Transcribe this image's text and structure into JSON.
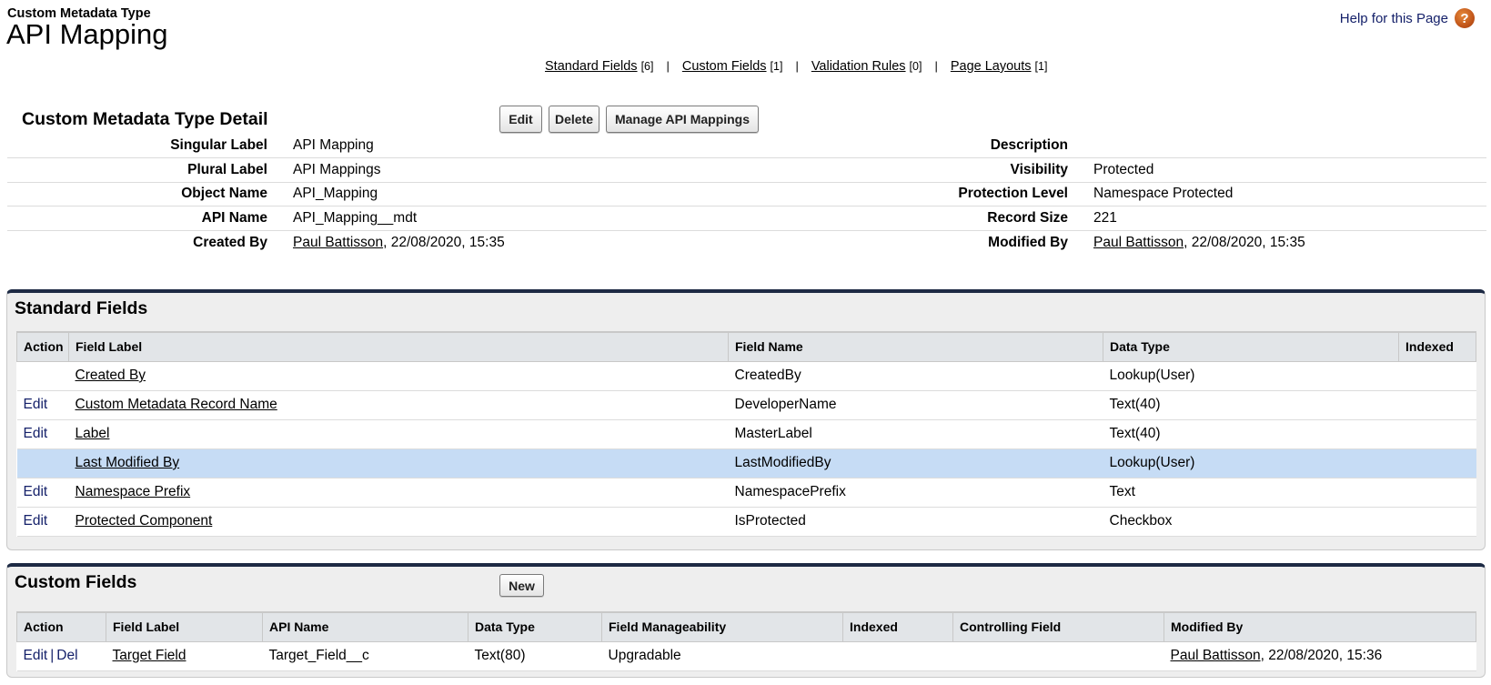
{
  "header": {
    "object_type": "Custom Metadata Type",
    "title": "API Mapping",
    "help_link": "Help for this Page",
    "help_icon": "question-mark-icon"
  },
  "related_links": [
    {
      "label": "Standard Fields",
      "count": "[6]"
    },
    {
      "label": "Custom Fields",
      "count": "[1]"
    },
    {
      "label": "Validation Rules",
      "count": "[0]"
    },
    {
      "label": "Page Layouts",
      "count": "[1]"
    }
  ],
  "related_separator": "|",
  "detail": {
    "title": "Custom Metadata Type Detail",
    "buttons": {
      "edit": "Edit",
      "delete": "Delete",
      "manage": "Manage API Mappings"
    },
    "rows": [
      {
        "left_label": "Singular Label",
        "left_value": "API Mapping",
        "right_label": "Description",
        "right_value": ""
      },
      {
        "left_label": "Plural Label",
        "left_value": "API Mappings",
        "right_label": "Visibility",
        "right_value": "Protected"
      },
      {
        "left_label": "Object Name",
        "left_value": "API_Mapping",
        "right_label": "Protection Level",
        "right_value": "Namespace Protected"
      },
      {
        "left_label": "API Name",
        "left_value": "API_Mapping__mdt",
        "right_label": "Record Size",
        "right_value": "221"
      }
    ],
    "created_by": {
      "label": "Created By",
      "user": "Paul Battisson",
      "date": ", 22/08/2020, 15:35"
    },
    "modified_by": {
      "label": "Modified By",
      "user": "Paul Battisson",
      "date": ", 22/08/2020, 15:35"
    }
  },
  "standard_fields": {
    "title": "Standard Fields",
    "columns": [
      "Action",
      "Field Label",
      "Field Name",
      "Data Type",
      "Indexed"
    ],
    "rows": [
      {
        "action": "",
        "label": "Created By",
        "name": "CreatedBy",
        "type": "Lookup(User)",
        "indexed": ""
      },
      {
        "action": "Edit",
        "label": "Custom Metadata Record Name",
        "name": "DeveloperName",
        "type": "Text(40)",
        "indexed": ""
      },
      {
        "action": "Edit",
        "label": "Label",
        "name": "MasterLabel",
        "type": "Text(40)",
        "indexed": ""
      },
      {
        "action": "",
        "label": "Last Modified By",
        "name": "LastModifiedBy",
        "type": "Lookup(User)",
        "indexed": "",
        "highlighted": true
      },
      {
        "action": "Edit",
        "label": "Namespace Prefix",
        "name": "NamespacePrefix",
        "type": "Text",
        "indexed": ""
      },
      {
        "action": "Edit",
        "label": "Protected Component",
        "name": "IsProtected",
        "type": "Checkbox",
        "indexed": ""
      }
    ]
  },
  "custom_fields": {
    "title": "Custom Fields",
    "new_button": "New",
    "columns": [
      "Action",
      "Field Label",
      "API Name",
      "Data Type",
      "Field Manageability",
      "Indexed",
      "Controlling Field",
      "Modified By"
    ],
    "rows": [
      {
        "action_edit": "Edit",
        "action_sep": "|",
        "action_del": "Del",
        "label": "Target Field",
        "api_name": "Target_Field__c",
        "type": "Text(80)",
        "manageability": "Upgradable",
        "indexed": "",
        "controlling": "",
        "modified_user": "Paul Battisson",
        "modified_date": ", 22/08/2020, 15:36"
      }
    ]
  },
  "colors": {
    "panel_top_border": "#1d2a44",
    "highlight_row": "#c6dcf5",
    "action_link": "#15216a",
    "help_icon": "#c2561a"
  }
}
